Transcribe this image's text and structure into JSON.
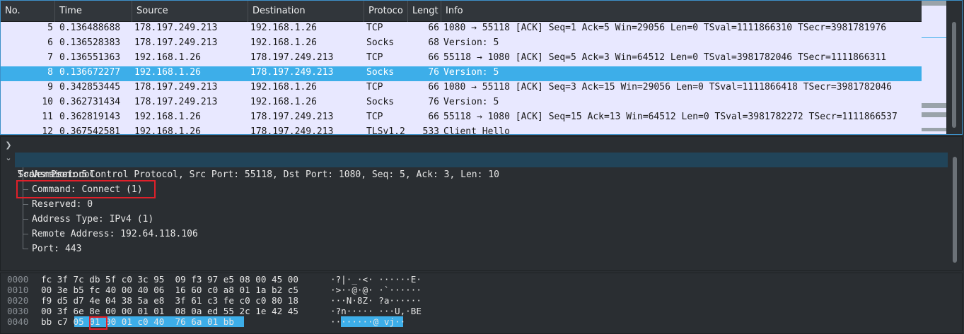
{
  "packet_list": {
    "columns": [
      "No.",
      "Time",
      "Source",
      "Destination",
      "Protoco",
      "Lengt",
      "Info"
    ],
    "rows": [
      {
        "no": "5",
        "time": "0.136488688",
        "src": "178.197.249.213",
        "dst": "192.168.1.26",
        "proto": "TCP",
        "len": "66",
        "info": "1080 → 55118 [ACK] Seq=1 Ack=5 Win=29056 Len=0 TSval=1111866310 TSecr=3981781976",
        "selected": false
      },
      {
        "no": "6",
        "time": "0.136528383",
        "src": "178.197.249.213",
        "dst": "192.168.1.26",
        "proto": "Socks",
        "len": "68",
        "info": "Version: 5",
        "selected": false
      },
      {
        "no": "7",
        "time": "0.136551363",
        "src": "192.168.1.26",
        "dst": "178.197.249.213",
        "proto": "TCP",
        "len": "66",
        "info": "55118 → 1080 [ACK] Seq=5 Ack=3 Win=64512 Len=0 TSval=3981782046 TSecr=1111866311",
        "selected": false
      },
      {
        "no": "8",
        "time": "0.136672277",
        "src": "192.168.1.26",
        "dst": "178.197.249.213",
        "proto": "Socks",
        "len": "76",
        "info": "Version: 5",
        "selected": true
      },
      {
        "no": "9",
        "time": "0.342853445",
        "src": "178.197.249.213",
        "dst": "192.168.1.26",
        "proto": "TCP",
        "len": "66",
        "info": "1080 → 55118 [ACK] Seq=3 Ack=15 Win=29056 Len=0 TSval=1111866418 TSecr=3981782046",
        "selected": false
      },
      {
        "no": "10",
        "time": "0.362731434",
        "src": "178.197.249.213",
        "dst": "192.168.1.26",
        "proto": "Socks",
        "len": "76",
        "info": "Version: 5",
        "selected": false
      },
      {
        "no": "11",
        "time": "0.362819143",
        "src": "192.168.1.26",
        "dst": "178.197.249.213",
        "proto": "TCP",
        "len": "66",
        "info": "55118 → 1080 [ACK] Seq=15 Ack=13 Win=64512 Len=0 TSval=3981782272 TSecr=1111866537",
        "selected": false
      },
      {
        "no": "12",
        "time": "0.367542581",
        "src": "192.168.1.26",
        "dst": "178.197.249.213",
        "proto": "TLSv1.2",
        "len": "533",
        "info": "Client Hello",
        "selected": false
      }
    ]
  },
  "detail": {
    "tcp_line": "Transmission Control Protocol, Src Port: 55118, Dst Port: 1080, Seq: 5, Ack: 3, Len: 10",
    "socks_title": "Socks Protocol",
    "fields": [
      "Version: 5",
      "Command: Connect (1)",
      "Reserved: 0",
      "Address Type: IPv4 (1)",
      "Remote Address: 192.64.118.106",
      "Port: 443"
    ],
    "collapsed_icon": "chevron-right-icon",
    "expanded_icon": "chevron-down-icon"
  },
  "hex": {
    "lines": [
      {
        "offset": "0000",
        "bytes": "fc 3f 7c db 5f c0 3c 95  09 f3 97 e5 08 00 45 00",
        "ascii": "·?|·_·<· ······E·"
      },
      {
        "offset": "0010",
        "bytes": "00 3e b5 fc 40 00 40 06  16 60 c0 a8 01 1a b2 c5",
        "ascii": "·>··@·@· ·`······"
      },
      {
        "offset": "0020",
        "bytes": "f9 d5 d7 4e 04 38 5a e8  3f 61 c3 fe c0 c0 80 18",
        "ascii": "···N·8Z· ?a······"
      },
      {
        "offset": "0030",
        "bytes": "00 3f 6e 8e 00 00 01 01  08 0a ed 55 2c 1e 42 45",
        "ascii": "·?n····· ···U,·BE"
      },
      {
        "offset": "0040",
        "bytes": "bb c7 05 01 00 01 c0 40  76 6a 01 bb",
        "ascii": "········@ vj··"
      }
    ]
  },
  "colors": {
    "selection": "#3daee9",
    "row_bg": "#e8e8ff",
    "highlight_box": "#e0202a"
  }
}
